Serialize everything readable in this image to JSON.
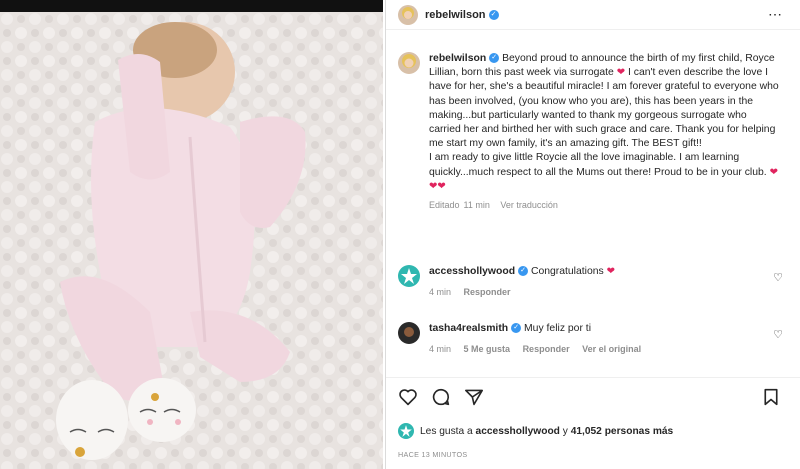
{
  "post": {
    "author": "rebelwilson",
    "caption": {
      "username": "rebelwilson",
      "text1": "Beyond proud to announce the birth of my first child, Royce Lillian, born this past week via surrogate",
      "text2": "I can't even describe the love I have for her, she's a beautiful miracle! I am forever grateful to everyone who has been involved, (you know who you are), this has been years in the making...but particularly wanted to thank my gorgeous surrogate who carried her and birthed her with such grace and care. Thank you for helping me start my own family, it's an amazing gift. The BEST gift!!",
      "text3": "I am ready to give little Roycie all the love imaginable. I am learning quickly...much respect to all the Mums out there! Proud to be in your club.",
      "heart_emoji": "❤",
      "hearts_emoji": "❤❤❤",
      "edited": "Editado",
      "time": "11 min",
      "translate": "Ver traducción"
    },
    "comments": [
      {
        "username": "accesshollywood",
        "text": "Congratulations",
        "emoji": "❤",
        "time": "4 min",
        "reply": "Responder"
      },
      {
        "username": "tasha4realsmith",
        "text": "Muy feliz por ti",
        "time": "4 min",
        "likes": "5 Me gusta",
        "reply": "Responder",
        "original": "Ver el original"
      }
    ],
    "likes": {
      "prefix": "Les gusta a",
      "user": "accesshollywood",
      "middle": "y",
      "count": "41,052",
      "suffix": "personas más"
    },
    "time_ago": "HACE 13 MINUTOS",
    "more_icon": "⋯"
  },
  "icons": [
    "more-options-icon",
    "verified-badge-icon",
    "heart-icon",
    "comment-icon",
    "share-icon",
    "bookmark-icon",
    "star-avatar-icon"
  ],
  "colors": {
    "accent": "#3897f0",
    "heart": "#e0245e",
    "muted": "#8e8e8e",
    "access_teal": "#2fb7b0"
  }
}
